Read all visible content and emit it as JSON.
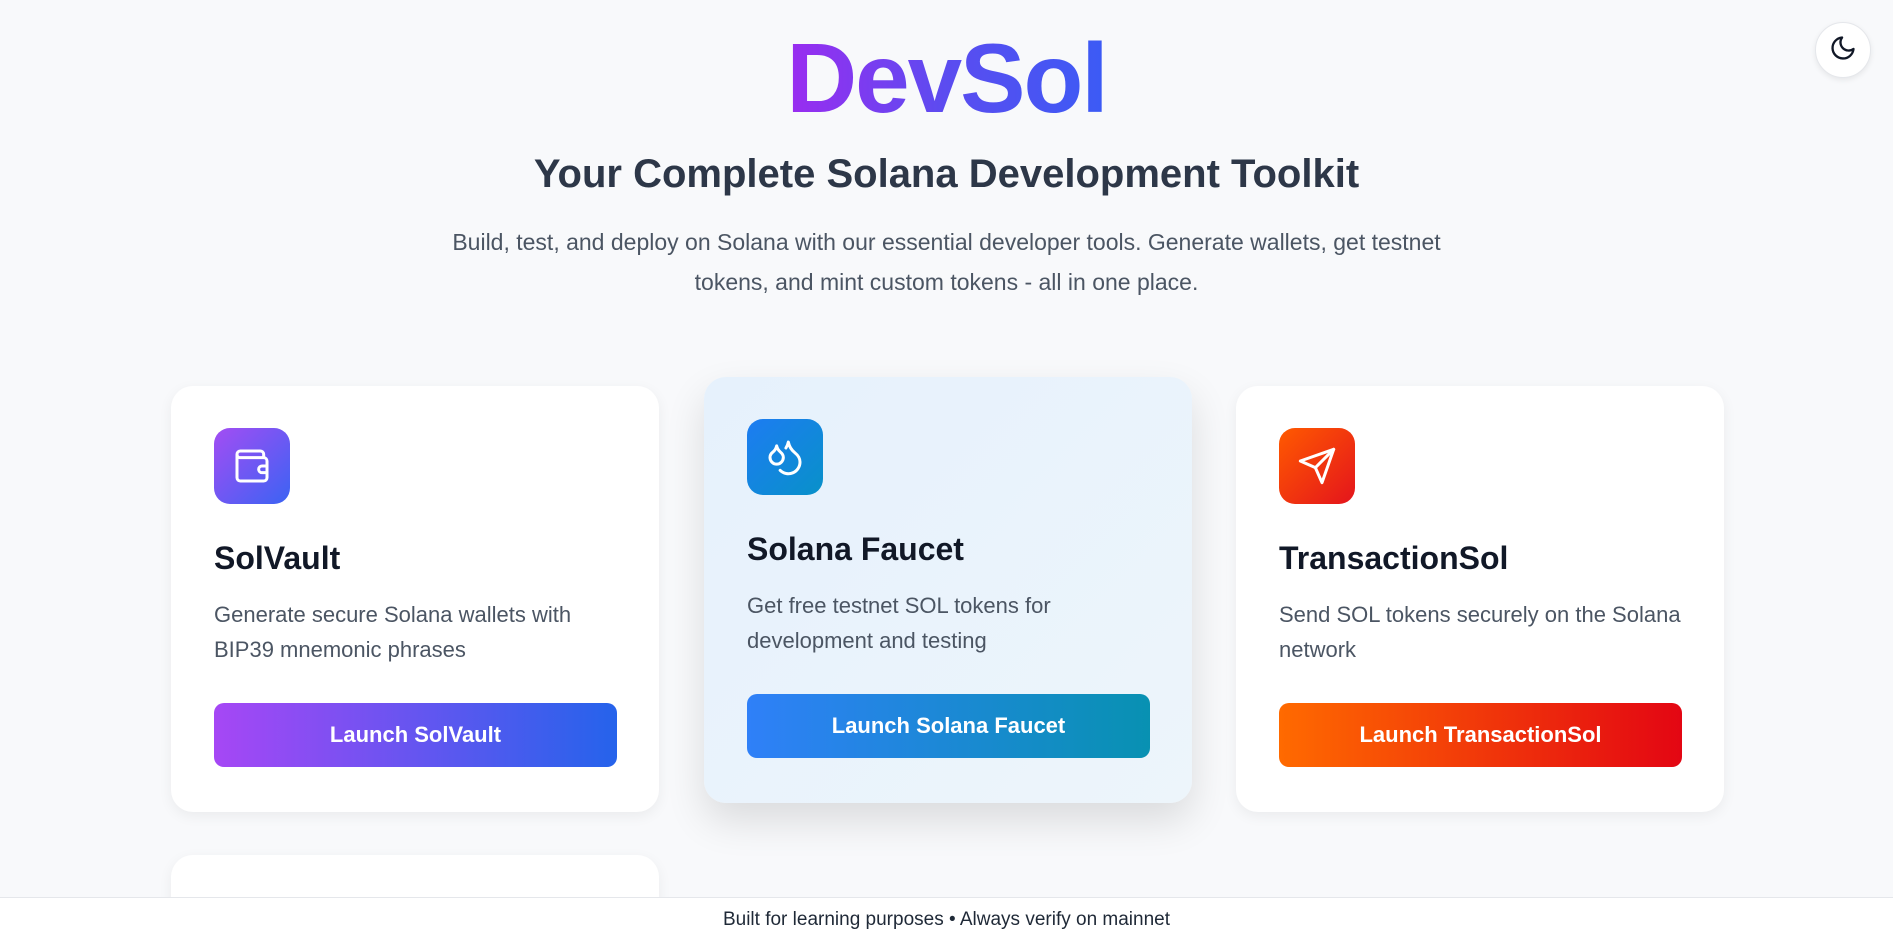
{
  "theme_toggle": {
    "icon": "moon-icon"
  },
  "hero": {
    "logo": "DevSol",
    "subtitle": "Your Complete Solana Development Toolkit",
    "description_line1": "Build, test, and deploy on Solana with our essential developer tools. Generate wallets, get testnet",
    "description_line2": "tokens, and mint custom tokens - all in one place."
  },
  "cards": [
    {
      "icon": "wallet-icon",
      "title": "SolVault",
      "description": "Generate secure Solana wallets with BIP39 mnemonic phrases",
      "button": "Launch SolVault",
      "gradient": [
        "#a647f5",
        "#2563eb"
      ]
    },
    {
      "icon": "droplets-icon",
      "title": "Solana Faucet",
      "description": "Get free testnet SOL tokens for development and testing",
      "button": "Launch Solana Faucet",
      "gradient": [
        "#2f80f8",
        "#0891b2"
      ]
    },
    {
      "icon": "send-icon",
      "title": "TransactionSol",
      "description": "Send SOL tokens securely on the Solana network",
      "button": "Launch TransactionSol",
      "gradient": [
        "#ff6a00",
        "#e30613"
      ]
    }
  ],
  "footer": {
    "text": "Built for learning purposes • Always verify on mainnet"
  }
}
